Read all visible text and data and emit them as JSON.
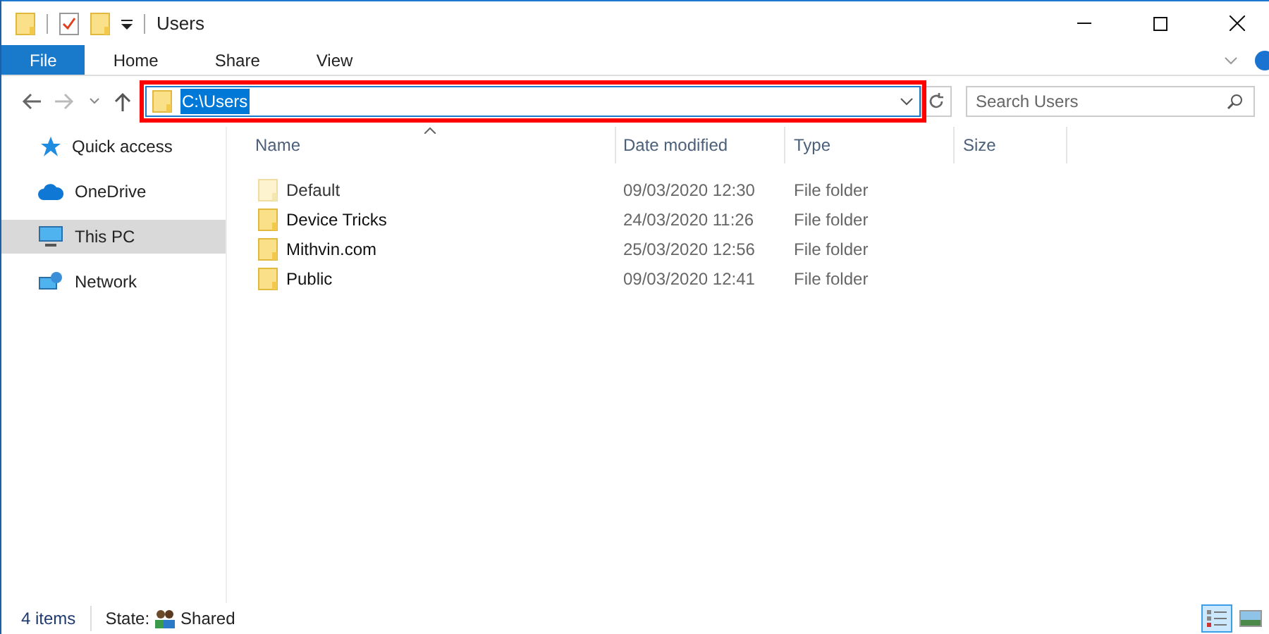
{
  "window": {
    "title": "Users"
  },
  "ribbon_tabs": [
    {
      "label": "File",
      "selected": true
    },
    {
      "label": "Home",
      "selected": false
    },
    {
      "label": "Share",
      "selected": false
    },
    {
      "label": "View",
      "selected": false
    }
  ],
  "address_bar": {
    "path": "C:\\Users",
    "text_selected": true,
    "highlighted": true
  },
  "search": {
    "placeholder": "Search Users"
  },
  "sidebar": {
    "items": [
      {
        "label": "Quick access",
        "kind": "star",
        "selected": false
      },
      {
        "label": "OneDrive",
        "kind": "cloud",
        "selected": false
      },
      {
        "label": "This PC",
        "kind": "pc",
        "selected": true
      },
      {
        "label": "Network",
        "kind": "network",
        "selected": false
      }
    ]
  },
  "table": {
    "columns": [
      "Name",
      "Date modified",
      "Type",
      "Size"
    ],
    "rows": [
      {
        "name": "Default",
        "date": "09/03/2020 12:30",
        "type": "File folder",
        "hidden": true
      },
      {
        "name": "Device Tricks",
        "date": "24/03/2020 11:26",
        "type": "File folder",
        "hidden": false
      },
      {
        "name": "Mithvin.com",
        "date": "25/03/2020 12:56",
        "type": "File folder",
        "hidden": false
      },
      {
        "name": "Public",
        "date": "09/03/2020 12:41",
        "type": "File folder",
        "hidden": false
      }
    ]
  },
  "status_bar": {
    "count": "4 items",
    "state_label": "State:",
    "state_value": "Shared"
  },
  "view_buttons": [
    {
      "kind": "details",
      "selected": true
    },
    {
      "kind": "thumbnails",
      "selected": false
    }
  ]
}
